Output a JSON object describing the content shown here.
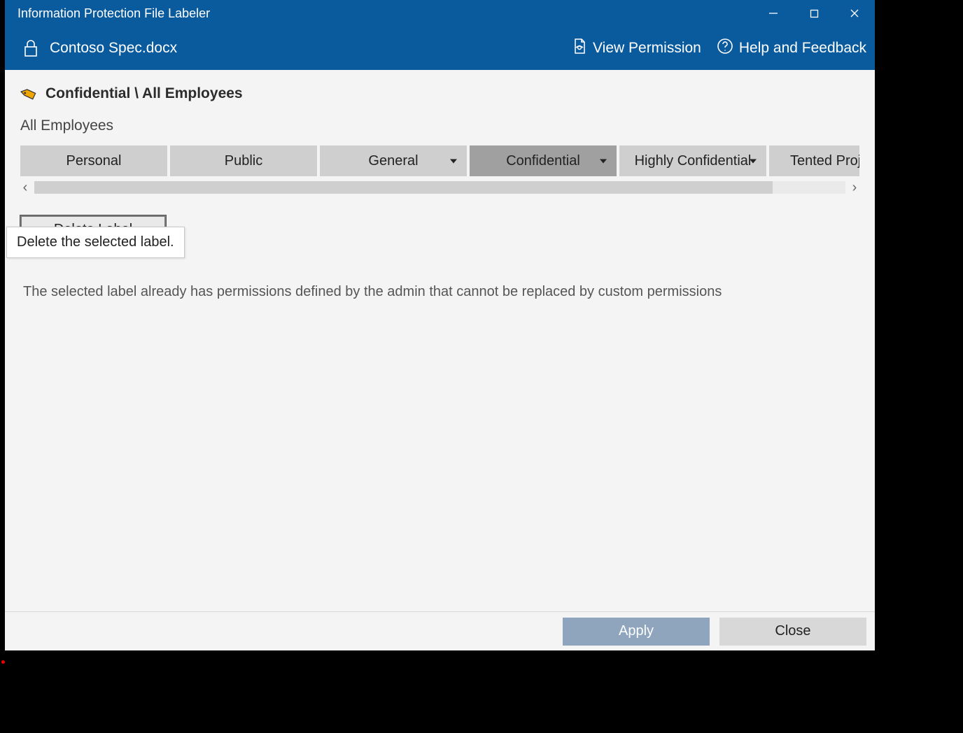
{
  "window": {
    "title": "Information Protection File Labeler",
    "file_name": "Contoso Spec.docx"
  },
  "header_links": {
    "view_permission": "View Permission",
    "help_feedback": "Help and Feedback"
  },
  "label": {
    "path": "Confidential \\ All Employees",
    "sublabel": "All Employees"
  },
  "label_buttons": [
    {
      "label": "Personal",
      "has_dropdown": false,
      "selected": false
    },
    {
      "label": "Public",
      "has_dropdown": false,
      "selected": false
    },
    {
      "label": "General",
      "has_dropdown": true,
      "selected": false
    },
    {
      "label": "Confidential",
      "has_dropdown": true,
      "selected": true
    },
    {
      "label": "Highly Confidential",
      "has_dropdown": true,
      "selected": false
    },
    {
      "label": "Tented Projec",
      "has_dropdown": false,
      "selected": false
    }
  ],
  "actions": {
    "delete_label": "Delete Label",
    "delete_tooltip": "Delete the selected label."
  },
  "info_text": "The selected label already has permissions defined by the admin that cannot be replaced by custom permissions",
  "footer": {
    "apply": "Apply",
    "close": "Close"
  }
}
